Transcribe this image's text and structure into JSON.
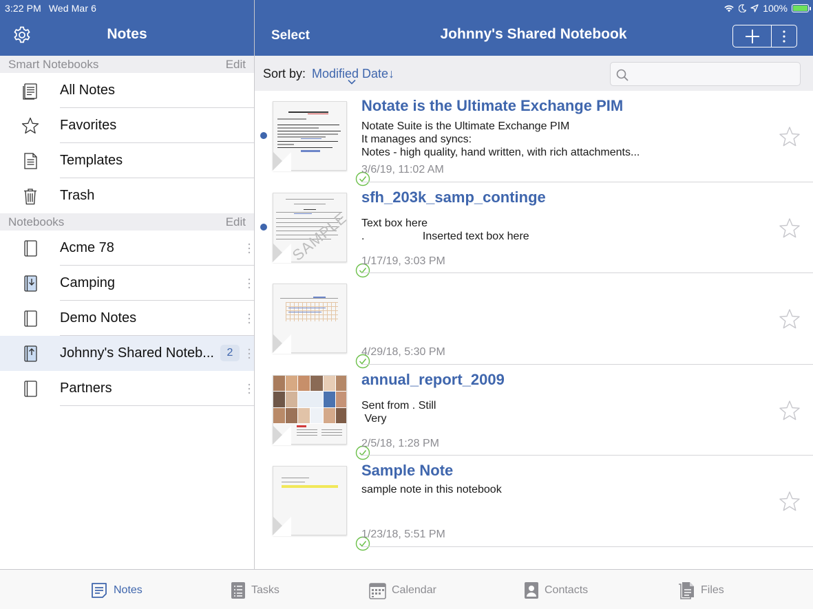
{
  "status_bar": {
    "time": "3:22 PM",
    "date": "Wed Mar 6",
    "battery": "100%",
    "battery_level": 1.0
  },
  "sidebar": {
    "title": "Notes",
    "smart_header": "Smart Notebooks",
    "smart_edit": "Edit",
    "smart_items": [
      {
        "label": "All Notes",
        "icon": "all-notes-icon"
      },
      {
        "label": "Favorites",
        "icon": "star-icon"
      },
      {
        "label": "Templates",
        "icon": "template-icon"
      },
      {
        "label": "Trash",
        "icon": "trash-icon"
      }
    ],
    "notebooks_header": "Notebooks",
    "notebooks_edit": "Edit",
    "notebooks": [
      {
        "label": "Acme 78",
        "icon": "notebook-icon"
      },
      {
        "label": "Camping",
        "icon": "notebook-download-icon"
      },
      {
        "label": "Demo Notes",
        "icon": "notebook-icon"
      },
      {
        "label": "Johnny's Shared Noteb...",
        "icon": "notebook-shared-icon",
        "count": "2",
        "selected": true
      },
      {
        "label": "Partners",
        "icon": "notebook-icon"
      }
    ]
  },
  "header": {
    "select": "Select",
    "title": "Johnny's Shared Notebook"
  },
  "sort": {
    "label": "Sort by:",
    "value": "Modified Date↓"
  },
  "search": {
    "placeholder": ""
  },
  "notes": [
    {
      "title": "Notate is the Ultimate Exchange PIM",
      "body": "Notate Suite is the Ultimate Exchange PIM\nIt manages and syncs:\nNotes - high quality, hand written, with rich attachments...",
      "date": "3/6/19, 11:02 AM",
      "unread": true
    },
    {
      "title": "sfh_203k_samp_continge",
      "body": "Text box here\n.                   Inserted text box here",
      "date": "1/17/19, 3:03 PM",
      "unread": true
    },
    {
      "title": "",
      "body": "",
      "date": "4/29/18, 5:30 PM",
      "unread": false
    },
    {
      "title": "annual_report_2009",
      "body": "Sent from . Still\n Very",
      "date": "2/5/18, 1:28 PM",
      "unread": false
    },
    {
      "title": "Sample Note",
      "body": "sample note in this notebook",
      "date": "1/23/18, 5:51 PM",
      "unread": false
    }
  ],
  "tabs": [
    {
      "label": "Notes",
      "icon": "notes-tab-icon",
      "active": true
    },
    {
      "label": "Tasks",
      "icon": "tasks-tab-icon"
    },
    {
      "label": "Calendar",
      "icon": "calendar-tab-icon"
    },
    {
      "label": "Contacts",
      "icon": "contacts-tab-icon"
    },
    {
      "label": "Files",
      "icon": "files-tab-icon"
    }
  ],
  "colors": {
    "brand": "#3f66ad",
    "sync_check": "#6cc04a",
    "unread_dot": "#3f66ad"
  }
}
